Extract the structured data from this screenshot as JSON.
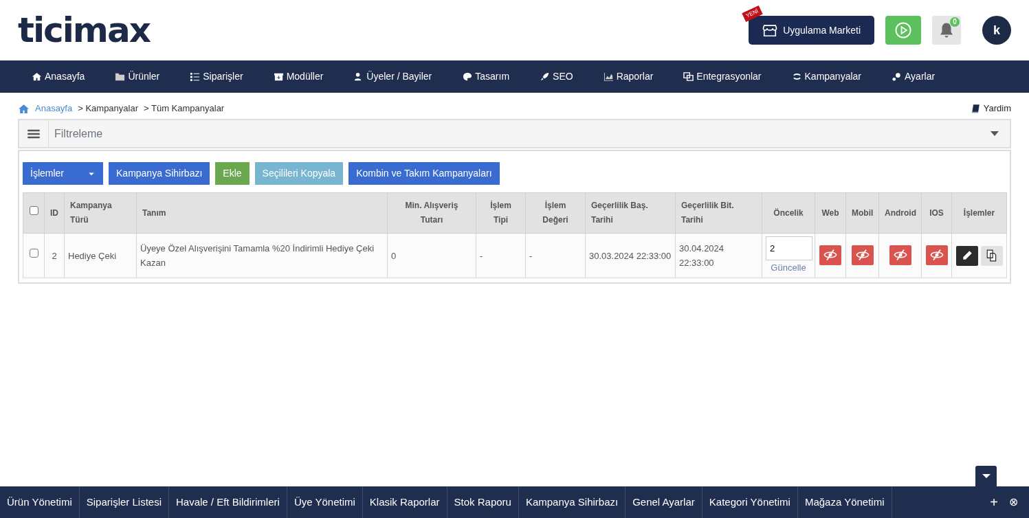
{
  "logo": "ticimax",
  "header": {
    "new_badge": "YENİ",
    "market_button": "Uygulama Marketi",
    "notifications": {
      "count": "0"
    },
    "avatar": "k"
  },
  "nav": [
    "Anasayfa",
    "Ürünler",
    "Siparişler",
    "Modüller",
    "Üyeler / Bayiler",
    "Tasarım",
    "SEO",
    "Raporlar",
    "Entegrasyonlar",
    "Kampanyalar",
    "Ayarlar"
  ],
  "breadcrumb": [
    "Anasayfa",
    "> Kampanyalar",
    "> Tüm Kampanyalar"
  ],
  "help": "Yardim",
  "filter": {
    "title": "Filtreleme",
    "expanded": false
  },
  "toolbar": [
    {
      "label": "İşlemler",
      "kind": "dropdown"
    },
    {
      "label": "Kampanya Sihirbazı",
      "kind": "primary"
    },
    {
      "label": "Ekle",
      "kind": "success"
    },
    {
      "label": "Seçilileri Kopyala",
      "kind": "info"
    },
    {
      "label": "Kombin ve Takım Kampanyaları",
      "kind": "primary"
    }
  ],
  "table": {
    "columns": [
      "ID",
      "Kampanya Türü",
      "Tanım",
      "Min. Alışveriş Tutarı",
      "İşlem Tipi",
      "İşlem Değeri",
      "Geçerlilik Baş. Tarihi",
      "Geçerlilik Bit. Tarihi",
      "Öncelik",
      "Web",
      "Mobil",
      "Android",
      "IOS",
      "İşlemler"
    ],
    "all_checked": false,
    "rows": [
      {
        "checked": false,
        "id": "2",
        "type": "Hediye Çeki",
        "description": "Üyeye Özel Alışverişini Tamamla %20 İndirimli Hediye Çeki Kazan",
        "min_amount": "0",
        "op_type": "-",
        "op_value": "-",
        "start": "30.03.2024 22:33:00",
        "end": "30.04.2024 22:33:00",
        "priority": "2",
        "update_link": "Güncelle",
        "web_visible": false,
        "mobile_visible": false,
        "android_visible": false,
        "ios_visible": false
      }
    ]
  },
  "bottom_bar": [
    "Ürün Yönetimi",
    "Siparişler Listesi",
    "Havale / Eft Bildirimleri",
    "Üye Yönetimi",
    "Klasik Raporlar",
    "Stok Raporu",
    "Kampanya Sihirbazı",
    "Genel Ayarlar",
    "Kategori Yönetimi",
    "Mağaza Yönetimi"
  ],
  "bottom_actions": {
    "add": "+",
    "close": "⊗"
  }
}
